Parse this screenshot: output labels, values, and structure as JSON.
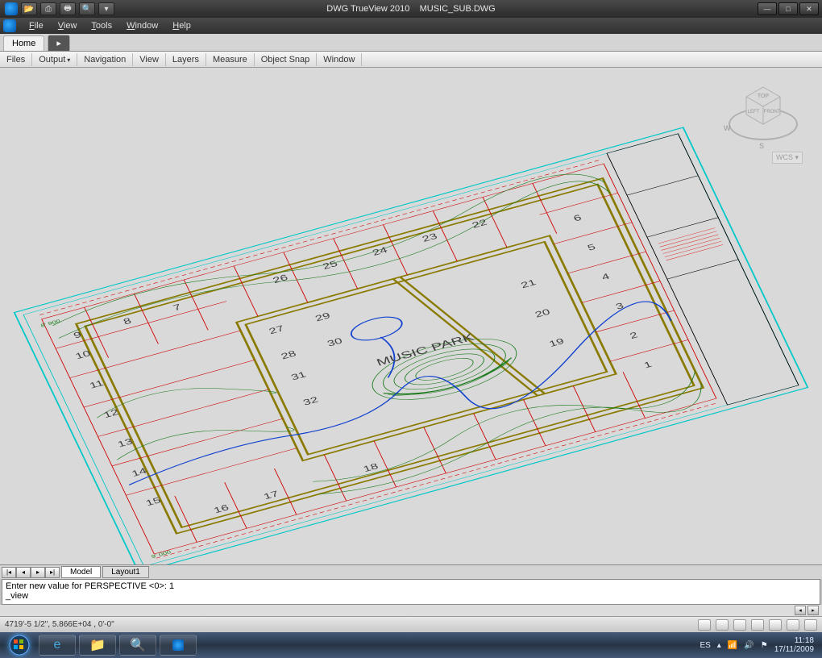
{
  "titlebar": {
    "app_title": "DWG TrueView 2010",
    "document_title": "MUSIC_SUB.DWG",
    "qat": [
      "open",
      "plot",
      "print",
      "search",
      "dropdown"
    ],
    "window_buttons": [
      "min",
      "max",
      "close"
    ]
  },
  "menubar": {
    "items": [
      "File",
      "View",
      "Tools",
      "Window",
      "Help"
    ]
  },
  "ribbon": {
    "tabs": [
      {
        "label": "Home",
        "active": true
      },
      {
        "label": "▸",
        "active": false
      }
    ],
    "panels": [
      "Files",
      "Output",
      "Navigation",
      "View",
      "Layers",
      "Measure",
      "Object Snap",
      "Window"
    ]
  },
  "viewcube": {
    "faces": {
      "top": "TOP",
      "left": "LEFT",
      "front": "FRONT"
    },
    "compass": {
      "w": "W",
      "s": "S"
    },
    "coord_system": "WCS ▾"
  },
  "drawing": {
    "title_park": "MUSIC PARK",
    "lot_numbers": [
      "1",
      "2",
      "3",
      "4",
      "5",
      "6",
      "7",
      "8",
      "9",
      "10",
      "11",
      "12",
      "13",
      "14",
      "15",
      "16",
      "17",
      "18",
      "19",
      "20",
      "21",
      "22",
      "23",
      "24",
      "25",
      "26",
      "27",
      "28",
      "29",
      "30",
      "31",
      "32"
    ],
    "colors": {
      "property_lines": "#d00000",
      "contours": "#1a7a1a",
      "road": "#8a7a00",
      "lot_text": "#404040",
      "water": "#1040d0",
      "border": "#00c8c8",
      "annotation": "#e02020"
    }
  },
  "layout_tabs": {
    "nav": [
      "|◂",
      "◂",
      "▸",
      "▸|"
    ],
    "tabs": [
      {
        "label": "Model",
        "active": true
      },
      {
        "label": "Layout1",
        "active": false
      }
    ]
  },
  "command": {
    "line1": "Enter new value for PERSPECTIVE <0>: 1",
    "line2": "_view"
  },
  "statusbar": {
    "coords": "4719'-5 1/2\", 5.866E+04 , 0'-0\"",
    "tray_icons": [
      "model",
      "grid",
      "snap",
      "ortho",
      "polar",
      "osnap",
      "dyn",
      "lwt",
      "qp"
    ]
  },
  "taskbar": {
    "apps": [
      "ie",
      "explorer",
      "magnifier",
      "trueview"
    ],
    "lang": "ES",
    "time": "11:18",
    "date": "17/11/2009"
  }
}
